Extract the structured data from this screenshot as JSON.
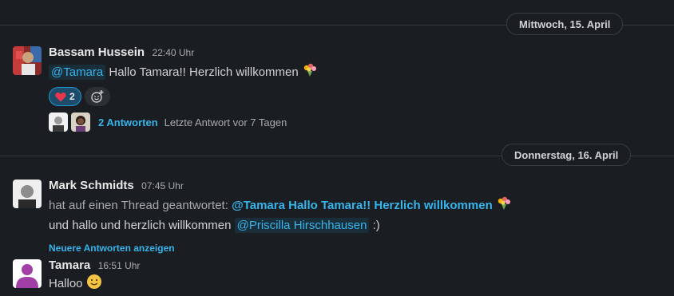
{
  "dividers": [
    {
      "label": "Mittwoch, 15. April"
    },
    {
      "label": "Donnerstag, 16. April"
    }
  ],
  "messages": {
    "m1": {
      "author": "Bassam Hussein",
      "time": "22:40 Uhr",
      "mention": "@Tamara",
      "text": "Hallo Tamara!! Herzlich willkommen",
      "emoji_icon": "bouquet-icon",
      "reaction": {
        "icon": "heart-icon",
        "count": "2"
      },
      "add_reaction_icon": "add-emoji-icon",
      "thread": {
        "link": "2 Antworten",
        "meta": "Letzte Antwort vor 7 Tagen"
      }
    },
    "m2": {
      "author": "Mark Schmidts",
      "time": "07:45 Uhr",
      "prefix": "hat auf einen Thread geantwortet:",
      "quote": "@Tamara Hallo Tamara!! Herzlich willkommen",
      "line2_text": "und hallo und herzlich willkommen",
      "line2_mention": "@Priscilla Hirschhausen",
      "line2_suffix": ":)",
      "more_link": "Neuere Antworten anzeigen"
    },
    "m3": {
      "author": "Tamara",
      "time": "16:51 Uhr",
      "text": "Halloo",
      "emoji_icon": "smiley-icon"
    }
  },
  "colors": {
    "background": "#1a1d21",
    "link": "#36b4ec",
    "reaction_active": "#1d4b6a"
  }
}
